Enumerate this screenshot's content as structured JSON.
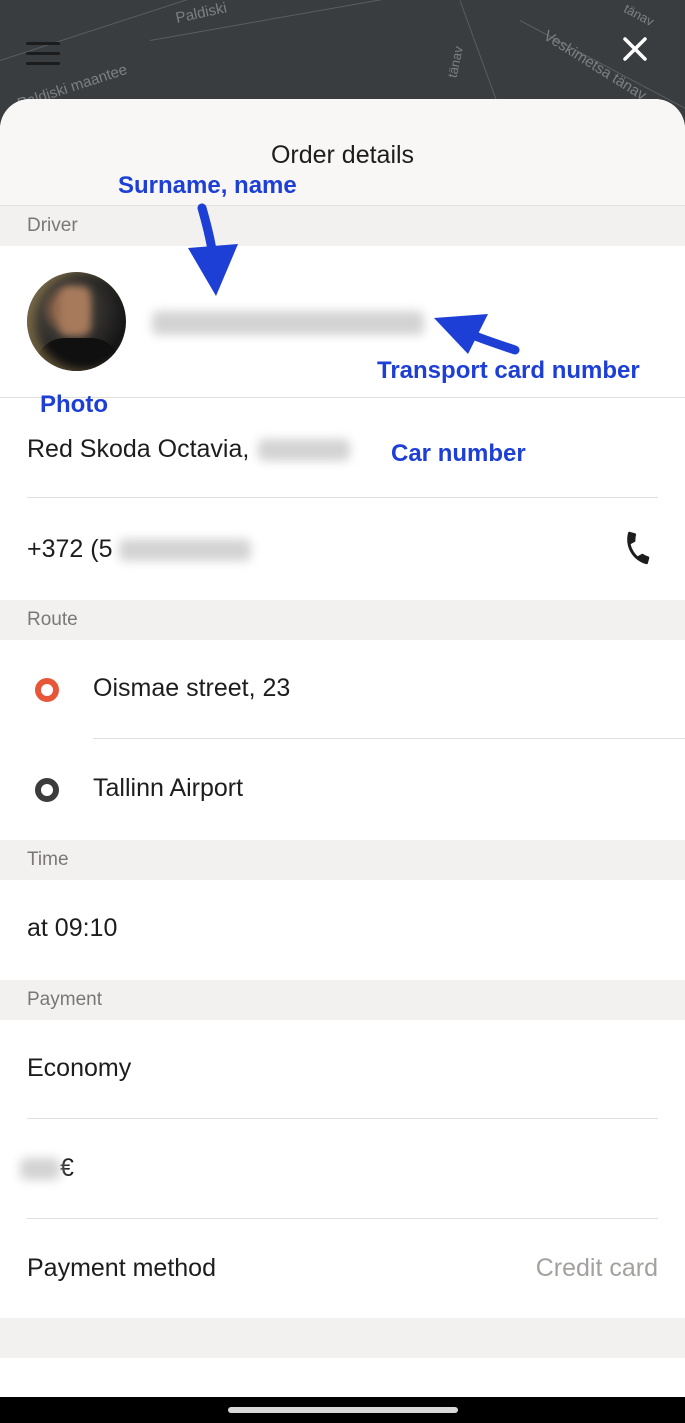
{
  "map": {
    "street_labels": [
      "Paldiski",
      "Paldiski maantee",
      "Veskimetsa tänav",
      "tänav",
      "tänav"
    ]
  },
  "sheet": {
    "title": "Order details"
  },
  "sections": {
    "driver": "Driver",
    "route": "Route",
    "time": "Time",
    "payment": "Payment"
  },
  "driver": {
    "car_prefix": "Red Skoda Octavia,",
    "phone_prefix": "+372 (5"
  },
  "route": {
    "from": "Oismae street, 23",
    "to": "Tallinn Airport"
  },
  "time": {
    "value": "at 09:10"
  },
  "payment": {
    "tariff": "Economy",
    "currency": "€",
    "method_label": "Payment method",
    "method_value": "Credit card"
  },
  "annotations": {
    "surname_name": "Surname, name",
    "transport_card": "Transport card number",
    "photo": "Photo",
    "car_number": "Car number"
  },
  "colors": {
    "annotation": "#1d3fd6",
    "route_from_dot": "#e8563a",
    "route_to_dot": "#3c3c3c"
  },
  "icons": [
    "menu-icon",
    "close-icon",
    "phone-icon"
  ]
}
